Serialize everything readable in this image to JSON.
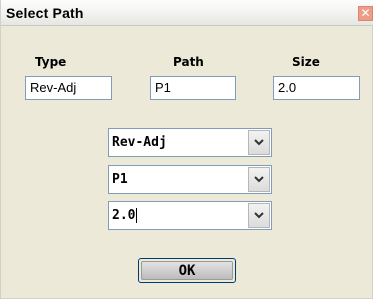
{
  "window": {
    "title": "Select Path",
    "close_glyph": "✕"
  },
  "headers": {
    "type": "Type",
    "path": "Path",
    "size": "Size"
  },
  "fields": {
    "type": "Rev-Adj",
    "path": "P1",
    "size": "2.0"
  },
  "combos": [
    {
      "value": "Rev-Adj"
    },
    {
      "value": "P1"
    },
    {
      "value": "2.0"
    }
  ],
  "buttons": {
    "ok": "OK"
  }
}
